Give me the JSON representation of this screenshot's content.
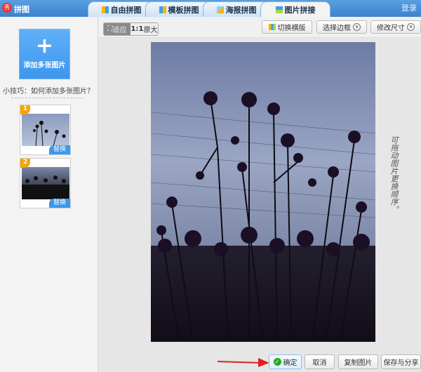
{
  "app": {
    "title": "拼图",
    "login": "登录"
  },
  "tabs": [
    {
      "label": "自由拼图"
    },
    {
      "label": "模板拼图"
    },
    {
      "label": "海报拼图"
    },
    {
      "label": "图片拼接",
      "active": true
    }
  ],
  "sidebar": {
    "add_label": "添加多张图片",
    "tip": "小技巧：如何添加多张图片？",
    "thumbs": [
      {
        "index": "1",
        "replace": "替换"
      },
      {
        "index": "2",
        "replace": "替换"
      }
    ]
  },
  "toolbar": {
    "fit": "适应",
    "original": "原大",
    "original_prefix": "1:1",
    "switch_layout": "切换横版",
    "select_border": "选择边框",
    "resize": "修改尺寸"
  },
  "hint": "可拖动图片更换顺序。",
  "footer": {
    "ok": "确定",
    "cancel": "取消",
    "copy": "复制图片",
    "save_share": "保存与分享"
  },
  "colors": {
    "accent": "#3d97ee",
    "arrow": "#e02020",
    "check": "#22aa22"
  }
}
